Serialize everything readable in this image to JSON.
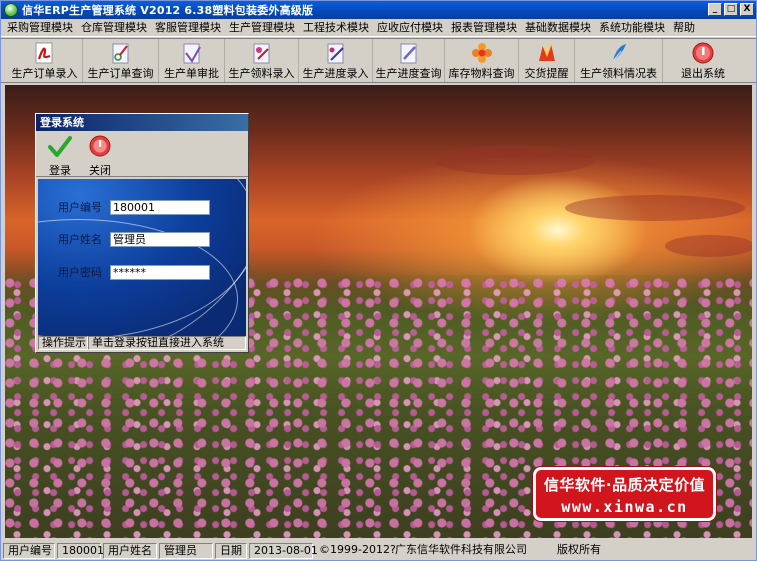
{
  "window": {
    "title": "信华ERP生产管理系统   V2012   6.38塑料包装委外高级版",
    "minimize": "_",
    "maximize": "□",
    "close": "X"
  },
  "menu": [
    "采购管理模块",
    "仓库管理模块",
    "客服管理模块",
    "生产管理模块",
    "工程技术模块",
    "应收应付模块",
    "报表管理模块",
    "基础数据模块",
    "系统功能模块",
    "帮助"
  ],
  "toolbar": [
    {
      "label": "生产订单录入",
      "icon": "pdf-icon"
    },
    {
      "label": "生产订单查询",
      "icon": "scissors-doc-icon"
    },
    {
      "label": "生产单审批",
      "icon": "approve-doc-icon"
    },
    {
      "label": "生产领料录入",
      "icon": "material-doc-icon"
    },
    {
      "label": "生产进度录入",
      "icon": "progress-doc-icon"
    },
    {
      "label": "生产进度查询",
      "icon": "query-doc-icon"
    },
    {
      "label": "库存物料查询",
      "icon": "flower-icon"
    },
    {
      "label": "交货提醒",
      "icon": "reminder-icon"
    },
    {
      "label": "生产领料情况表",
      "icon": "feather-icon"
    },
    {
      "label": "退出系统",
      "icon": "exit-icon"
    }
  ],
  "login": {
    "title": "登录系统",
    "login_label": "登录",
    "close_label": "关闭",
    "user_id_label": "用户编号",
    "user_id_value": "180001",
    "user_name_label": "用户姓名",
    "user_name_value": "管理员",
    "password_label": "用户密码",
    "password_value": "******",
    "hint_label": "操作提示",
    "hint_text": "单击登录按钮直接进入系统"
  },
  "brand": {
    "line1": "信华软件·品质决定价值",
    "line2": "www.xinwa.cn"
  },
  "status": {
    "user_id_label": "用户编号",
    "user_id_value": "180001",
    "user_name_label": "用户姓名",
    "user_name_value": "管理员",
    "date_label": "日期",
    "date_value": "2013-08-01",
    "copyright": "©1999-2012?",
    "company": "广东信华软件科技有限公司",
    "rights": "版权所有"
  },
  "colors": {
    "titlebar": "#0447b8",
    "brand_red": "#d0161c",
    "login_bg": "#0c3d9a"
  }
}
